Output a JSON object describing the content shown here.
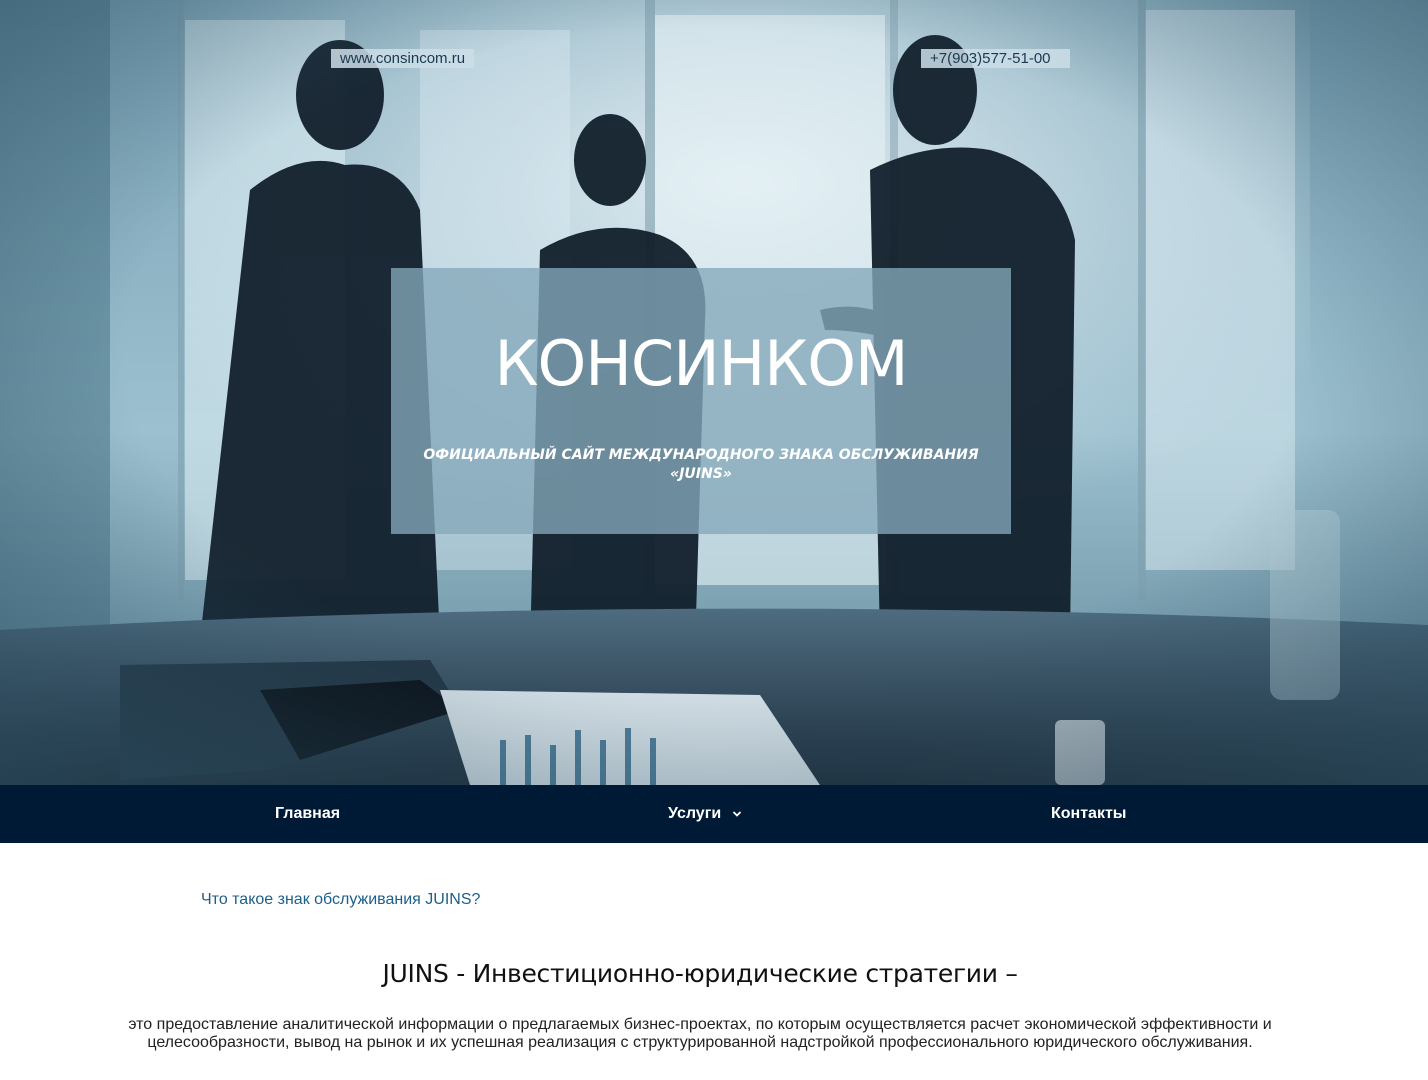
{
  "header": {
    "website": "www.consincom.ru",
    "phone": "+7(903)577-51-00"
  },
  "hero": {
    "brand": "КОНСИНКОМ",
    "tagline": "ОФИЦИАЛЬНЫЙ САЙТ МЕЖДУНАРОДНОГО ЗНАКА ОБСЛУЖИВАНИЯ «JUINS»"
  },
  "nav": {
    "items": [
      {
        "label": "Главная"
      },
      {
        "label": "Услуги"
      },
      {
        "label": "Контакты"
      }
    ]
  },
  "main": {
    "question_link": "Что такое знак обслуживания JUINS?",
    "heading": "JUINS - Инвестиционно-юридические стратегии –",
    "paragraph": "это предоставление аналитической информации о предлагаемых бизнес-проектах, по которым осуществляется расчет экономической эффективности и целесообразности, вывод на рынок и их успешная реализация с структурированной надстройкой профессионального юридического обслуживания."
  },
  "colors": {
    "nav_bg": "#001a36",
    "link": "#1c5f8a",
    "hero_tint": "#5f8fa3"
  },
  "icons": {
    "dropdown": "chevron-down-icon"
  }
}
